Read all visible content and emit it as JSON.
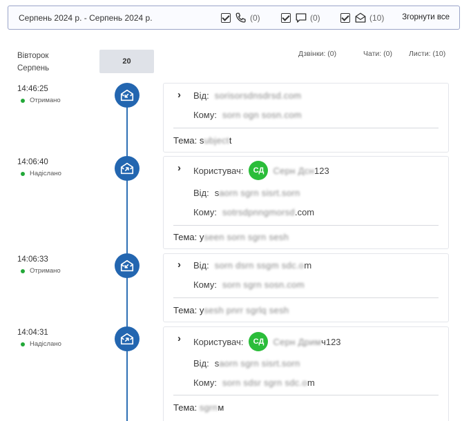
{
  "filter": {
    "range": "Серпень 2024 р. - Серпень 2024 р.",
    "calls_count": "(0)",
    "chats_count": "(0)",
    "mails_count": "(10)",
    "collapse_all": "Згорнути все"
  },
  "day": {
    "weekday": "Вівторок",
    "month": "Серпень",
    "date": "20",
    "calls": "Дзвінки: (0)",
    "chats": "Чати: (0)",
    "mails": "Листи: (10)"
  },
  "labels": {
    "from": "Від:",
    "to": "Кому:",
    "user": "Користувач:",
    "subject": "Тема:"
  },
  "entries": [
    {
      "time": "14:46:25",
      "status": "Отримано",
      "from_value": "sorisorsdnsdrsd.com",
      "to_value": "sorn ogn sosn.com",
      "subject_prefix": "Тема: s",
      "subject_blur": "ubject",
      "subject_suffix": "t"
    },
    {
      "time": "14:06:40",
      "status": "Надіслано",
      "user_avatar": "СД",
      "user_name_blur": "Серн Дсн",
      "user_name_suffix": "123",
      "from_prefix": "s",
      "from_value": "aorn sgrn sisrt.sorn",
      "to_value": "sotrsdpnngmorsd",
      "to_suffix": ".com",
      "subject_prefix": "Тема: у",
      "subject_blur": "seen sorn sgrn sesh"
    },
    {
      "time": "14:06:33",
      "status": "Отримано",
      "from_value": "sorn dsrn ssgm sdc.o",
      "from_suffix": "m",
      "to_value": "sorn sgrn sosn.com",
      "subject_prefix": "Тема: у",
      "subject_blur": "sesh pnrr sgrlq sesh"
    },
    {
      "time": "14:04:31",
      "status": "Надіслано",
      "user_avatar": "СД",
      "user_name_blur": "Серн Дрим",
      "user_name_suffix": "ч123",
      "from_prefix": "s",
      "from_value": "aorn sgrn sisrt.sorn",
      "to_value": "sorn sdsr sgrn sdc.o",
      "to_suffix": "m",
      "subject_prefix": "Тема: ",
      "subject_blur": "sgrn",
      "subject_suffix": "м"
    }
  ]
}
